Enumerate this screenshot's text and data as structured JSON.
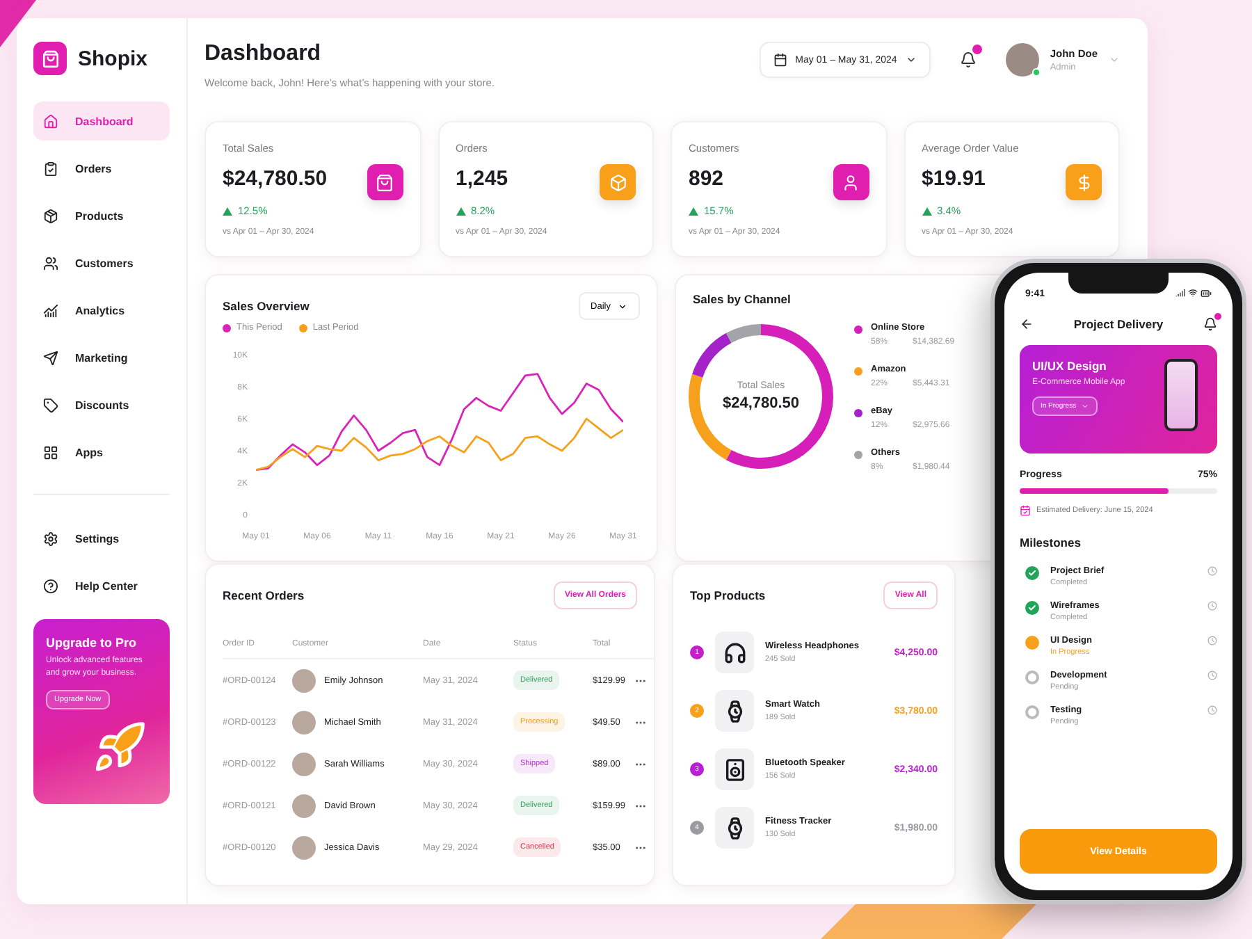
{
  "brand": {
    "name": "Shopix"
  },
  "nav": [
    {
      "label": "Dashboard",
      "selected": true
    },
    {
      "label": "Orders",
      "selected": false
    },
    {
      "label": "Products",
      "selected": false
    },
    {
      "label": "Customers",
      "selected": false
    },
    {
      "label": "Analytics",
      "selected": false
    },
    {
      "label": "Marketing",
      "selected": false
    },
    {
      "label": "Discounts",
      "selected": false
    },
    {
      "label": "Apps",
      "selected": false
    }
  ],
  "nav_bottom": [
    {
      "label": "Settings",
      "selected": false
    },
    {
      "label": "Help Center",
      "selected": false
    }
  ],
  "upgrade": {
    "title": "Upgrade to Pro",
    "text": "Unlock advanced features and grow your business.",
    "button": "Upgrade Now"
  },
  "header": {
    "title": "Dashboard",
    "subtitle": "Welcome back, John! Here’s what’s happening with your store.",
    "date_range": "May 01 – May 31, 2024",
    "user": {
      "name": "John Doe",
      "role": "Admin"
    }
  },
  "stats": [
    {
      "label": "Total Sales",
      "value": "$24,780.50",
      "change": "12.5%",
      "compare": "vs Apr 01 – Apr 30, 2024",
      "color": "#e01fb0"
    },
    {
      "label": "Orders",
      "value": "1,245",
      "change": "8.2%",
      "compare": "vs Apr 01 – Apr 30, 2024",
      "color": "#f8a01a"
    },
    {
      "label": "Customers",
      "value": "892",
      "change": "15.7%",
      "compare": "vs Apr 01 – Apr 30, 2024",
      "color": "#e01fb0"
    },
    {
      "label": "Average Order Value",
      "value": "$19.91",
      "change": "3.4%",
      "compare": "vs Apr 01 – Apr 30, 2024",
      "color": "#f8a01a"
    }
  ],
  "sales_overview": {
    "title": "Sales Overview",
    "period": "Daily",
    "chart_data": {
      "type": "line",
      "categories": [
        "May 01",
        null,
        null,
        null,
        null,
        "May 06",
        null,
        null,
        null,
        null,
        "May 11",
        null,
        null,
        null,
        null,
        "May 16",
        null,
        null,
        null,
        null,
        "May 21",
        null,
        null,
        null,
        null,
        "May 26",
        null,
        null,
        null,
        null,
        "May 31"
      ],
      "series": [
        {
          "name": "This Period",
          "color": "#d924b8",
          "values": [
            2800,
            2900,
            3700,
            4400,
            3900,
            3100,
            3700,
            5200,
            6200,
            5300,
            4000,
            4500,
            5100,
            5300,
            3600,
            3100,
            4700,
            6600,
            7300,
            6800,
            6500,
            7600,
            8700,
            8800,
            7300,
            6300,
            7000,
            8200,
            7800,
            6600,
            5800
          ]
        },
        {
          "name": "Last Period",
          "color": "#f7a01c",
          "values": [
            2800,
            3000,
            3600,
            4100,
            3600,
            4300,
            4100,
            4000,
            4800,
            4200,
            3400,
            3700,
            3800,
            4100,
            4600,
            4900,
            4300,
            3900,
            4900,
            4500,
            3400,
            3800,
            4800,
            4900,
            4400,
            4000,
            4800,
            6000,
            5400,
            4800,
            5300
          ]
        }
      ],
      "ylim": [
        0,
        10000
      ],
      "yticks": [
        {
          "value": 0,
          "label": "0"
        },
        {
          "value": 2000,
          "label": "2K"
        },
        {
          "value": 4000,
          "label": "4K"
        },
        {
          "value": 6000,
          "label": "6K"
        },
        {
          "value": 8000,
          "label": "8K"
        },
        {
          "value": 10000,
          "label": "10K"
        }
      ]
    }
  },
  "sales_by_channel": {
    "title": "Sales by Channel",
    "center_label": "Total Sales",
    "center_value": "$24,780.50",
    "channels": [
      {
        "percent": "58%",
        "amount": "$14,382.69",
        "color": "#d61fb9"
      },
      {
        "percent": "22%",
        "amount": "$5,443.31",
        "color": "#f7a01c"
      },
      {
        "percent": "12%",
        "amount": "$2,975.66",
        "color": "#a323c9"
      },
      {
        "percent": "8%",
        "amount": "$1,980.44",
        "color": "#a3a3a8"
      }
    ],
    "chart_data": {
      "type": "donut",
      "categories": [
        "Online Store",
        "Amazon",
        "eBay",
        "Others"
      ],
      "values": [
        58,
        22,
        12,
        8
      ]
    }
  },
  "recent_orders": {
    "title": "Recent Orders",
    "button": "View All Orders",
    "columns": [
      "Order ID",
      "Customer",
      "Date",
      "Status",
      "Total"
    ],
    "rows": [
      {
        "id": "#ORD-00124",
        "customer": "Emily Johnson",
        "date": "May 31, 2024",
        "status": "Delivered",
        "color": "#2f9e5b",
        "total": "$129.99"
      },
      {
        "id": "#ORD-00123",
        "customer": "Michael Smith",
        "date": "May 31, 2024",
        "status": "Processing",
        "color": "#f59a1c",
        "total": "$49.50"
      },
      {
        "id": "#ORD-00122",
        "customer": "Sarah Williams",
        "date": "May 30, 2024",
        "status": "Shipped",
        "color": "#b42fd0",
        "total": "$89.00"
      },
      {
        "id": "#ORD-00121",
        "customer": "David Brown",
        "date": "May 30, 2024",
        "status": "Delivered",
        "color": "#2f9e5b",
        "total": "$159.99"
      },
      {
        "id": "#ORD-00120",
        "customer": "Jessica Davis",
        "date": "May 29, 2024",
        "status": "Cancelled",
        "color": "#e3344f",
        "total": "$35.00"
      }
    ]
  },
  "top_products": {
    "title": "Top Products",
    "button": "View All",
    "items": [
      {
        "rank": "1",
        "name": "Wireless Headphones",
        "sold": "245 Sold",
        "price": "$4,250.00",
        "color": "#c21fc9"
      },
      {
        "rank": "2",
        "name": "Smart Watch",
        "sold": "189 Sold",
        "price": "$3,780.00",
        "color": "#f7a01c"
      },
      {
        "rank": "3",
        "name": "Bluetooth Speaker",
        "sold": "156 Sold",
        "price": "$2,340.00",
        "color": "#b61fd6"
      },
      {
        "rank": "4",
        "name": "Fitness Tracker",
        "sold": "130 Sold",
        "price": "$1,980.00",
        "color": "#9a9aa0"
      }
    ]
  },
  "phone": {
    "time": "9:41",
    "title": "Project Delivery",
    "project": {
      "title": "UI/UX Design",
      "subtitle": "E-Commerce Mobile App",
      "status": "In Progress"
    },
    "progress": {
      "label": "Progress",
      "value": "75%",
      "level": 0.75,
      "delivery": "Estimated Delivery: June 15, 2024"
    },
    "milestones_title": "Milestones",
    "milestones": [
      {
        "name": "Project Brief",
        "status": "Completed",
        "kind": "done"
      },
      {
        "name": "Wireframes",
        "status": "Completed",
        "kind": "done"
      },
      {
        "name": "UI Design",
        "status": "In Progress",
        "kind": "active"
      },
      {
        "name": "Development",
        "status": "Pending",
        "kind": "pending"
      },
      {
        "name": "Testing",
        "status": "Pending",
        "kind": "pending"
      }
    ],
    "button": "View Details"
  }
}
